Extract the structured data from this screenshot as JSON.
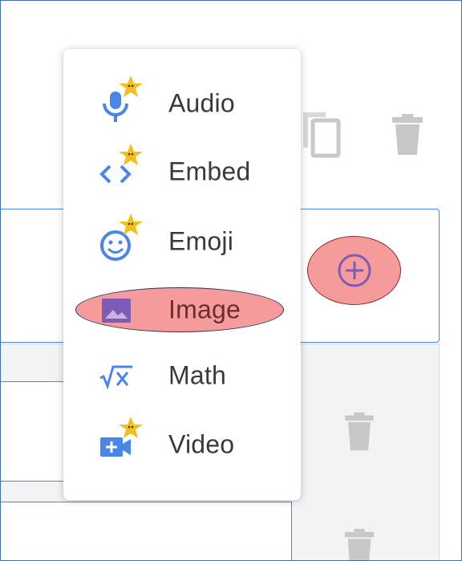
{
  "menu": {
    "items": [
      {
        "id": "audio",
        "label": "Audio",
        "icon": "microphone-icon",
        "premium": true
      },
      {
        "id": "embed",
        "label": "Embed",
        "icon": "code-brackets-icon",
        "premium": true
      },
      {
        "id": "emoji",
        "label": "Emoji",
        "icon": "smiley-icon",
        "premium": true
      },
      {
        "id": "image",
        "label": "Image",
        "icon": "image-icon",
        "premium": false,
        "highlighted": true
      },
      {
        "id": "math",
        "label": "Math",
        "icon": "square-root-x-icon",
        "premium": false
      },
      {
        "id": "video",
        "label": "Video",
        "icon": "video-camera-icon",
        "premium": true
      }
    ]
  },
  "toolbar": {
    "icons": [
      "copy-icon",
      "trash-icon"
    ]
  },
  "add_button": {
    "icon": "plus-circle-icon",
    "highlighted": true
  },
  "colors": {
    "accent_blue": "#4a86e8",
    "image_purple": "#7e5bb5",
    "highlight_fill": "#f59b9b",
    "star_gold": "#f2c01c",
    "icon_gray": "#c8c8c8"
  }
}
